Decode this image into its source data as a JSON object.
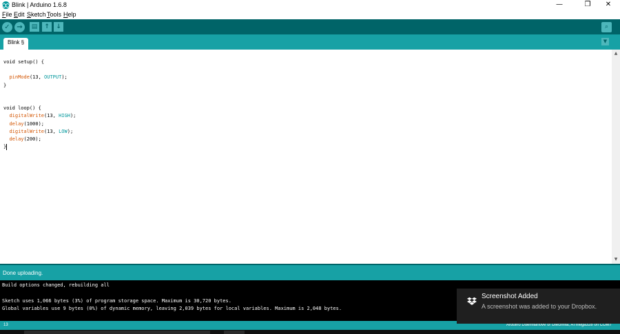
{
  "window": {
    "title": "Blink | Arduino 1.6.8",
    "minimize": "—",
    "maximize": "❐",
    "close": "✕"
  },
  "menu": {
    "items": [
      {
        "label": "File",
        "accel": "F",
        "rest": "ile"
      },
      {
        "label": "Edit",
        "accel": "E",
        "rest": "dit"
      },
      {
        "label": "Sketch",
        "accel": "S",
        "rest": "ketch"
      },
      {
        "label": "Tools",
        "accel": "T",
        "rest": "ools"
      },
      {
        "label": "Help",
        "accel": "H",
        "rest": "elp"
      }
    ]
  },
  "toolbar": {
    "verify": "✓",
    "upload": "→",
    "new": "▤",
    "open": "↑",
    "save": "↓",
    "serial_monitor": "⌕"
  },
  "tabs": {
    "active": "Blink §",
    "menu": "▼"
  },
  "editor": {
    "lines": [
      [
        {
          "t": "void setup() {",
          "c": ""
        }
      ],
      [
        {
          "t": "",
          "c": ""
        }
      ],
      [
        {
          "t": "  ",
          "c": ""
        },
        {
          "t": "pinMode",
          "c": "orange"
        },
        {
          "t": "(13, ",
          "c": ""
        },
        {
          "t": "OUTPUT",
          "c": "blue"
        },
        {
          "t": ");",
          "c": ""
        }
      ],
      [
        {
          "t": "}",
          "c": ""
        }
      ],
      [
        {
          "t": "",
          "c": ""
        }
      ],
      [
        {
          "t": "",
          "c": ""
        }
      ],
      [
        {
          "t": "void loop() {",
          "c": ""
        }
      ],
      [
        {
          "t": "  ",
          "c": ""
        },
        {
          "t": "digitalWrite",
          "c": "orange"
        },
        {
          "t": "(13, ",
          "c": ""
        },
        {
          "t": "HIGH",
          "c": "blue"
        },
        {
          "t": ");",
          "c": ""
        }
      ],
      [
        {
          "t": "  ",
          "c": ""
        },
        {
          "t": "delay",
          "c": "orange"
        },
        {
          "t": "(1000);",
          "c": ""
        }
      ],
      [
        {
          "t": "  ",
          "c": ""
        },
        {
          "t": "digitalWrite",
          "c": "orange"
        },
        {
          "t": "(13, ",
          "c": ""
        },
        {
          "t": "LOW",
          "c": "blue"
        },
        {
          "t": ");",
          "c": ""
        }
      ],
      [
        {
          "t": "  ",
          "c": ""
        },
        {
          "t": "delay",
          "c": "orange"
        },
        {
          "t": "(200);",
          "c": ""
        }
      ],
      [
        {
          "t": "}",
          "c": ""
        }
      ]
    ]
  },
  "scrollbar": {
    "up": "▲",
    "down": "▼"
  },
  "status": {
    "message": "Done uploading."
  },
  "console": {
    "lines": [
      "Build options changed, rebuilding all",
      "",
      "Sketch uses 1,066 bytes (3%) of program storage space. Maximum is 30,720 bytes.",
      "Global variables use 9 bytes (0%) of dynamic memory, leaving 2,039 bytes for local variables. Maximum is 2,048 bytes."
    ]
  },
  "footer": {
    "line_number": "13",
    "board": "Arduino Duemilanove or Diecimila, ATmega328 on COM7"
  },
  "notification": {
    "title": "Screenshot Added",
    "body": "A screenshot was added to your Dropbox.",
    "icon": "dropbox-icon"
  },
  "colors": {
    "toolbar": "#006468",
    "teal": "#17a1a5",
    "button": "#4db7bb",
    "keyword_orange": "#d35400",
    "keyword_blue": "#00979c"
  }
}
